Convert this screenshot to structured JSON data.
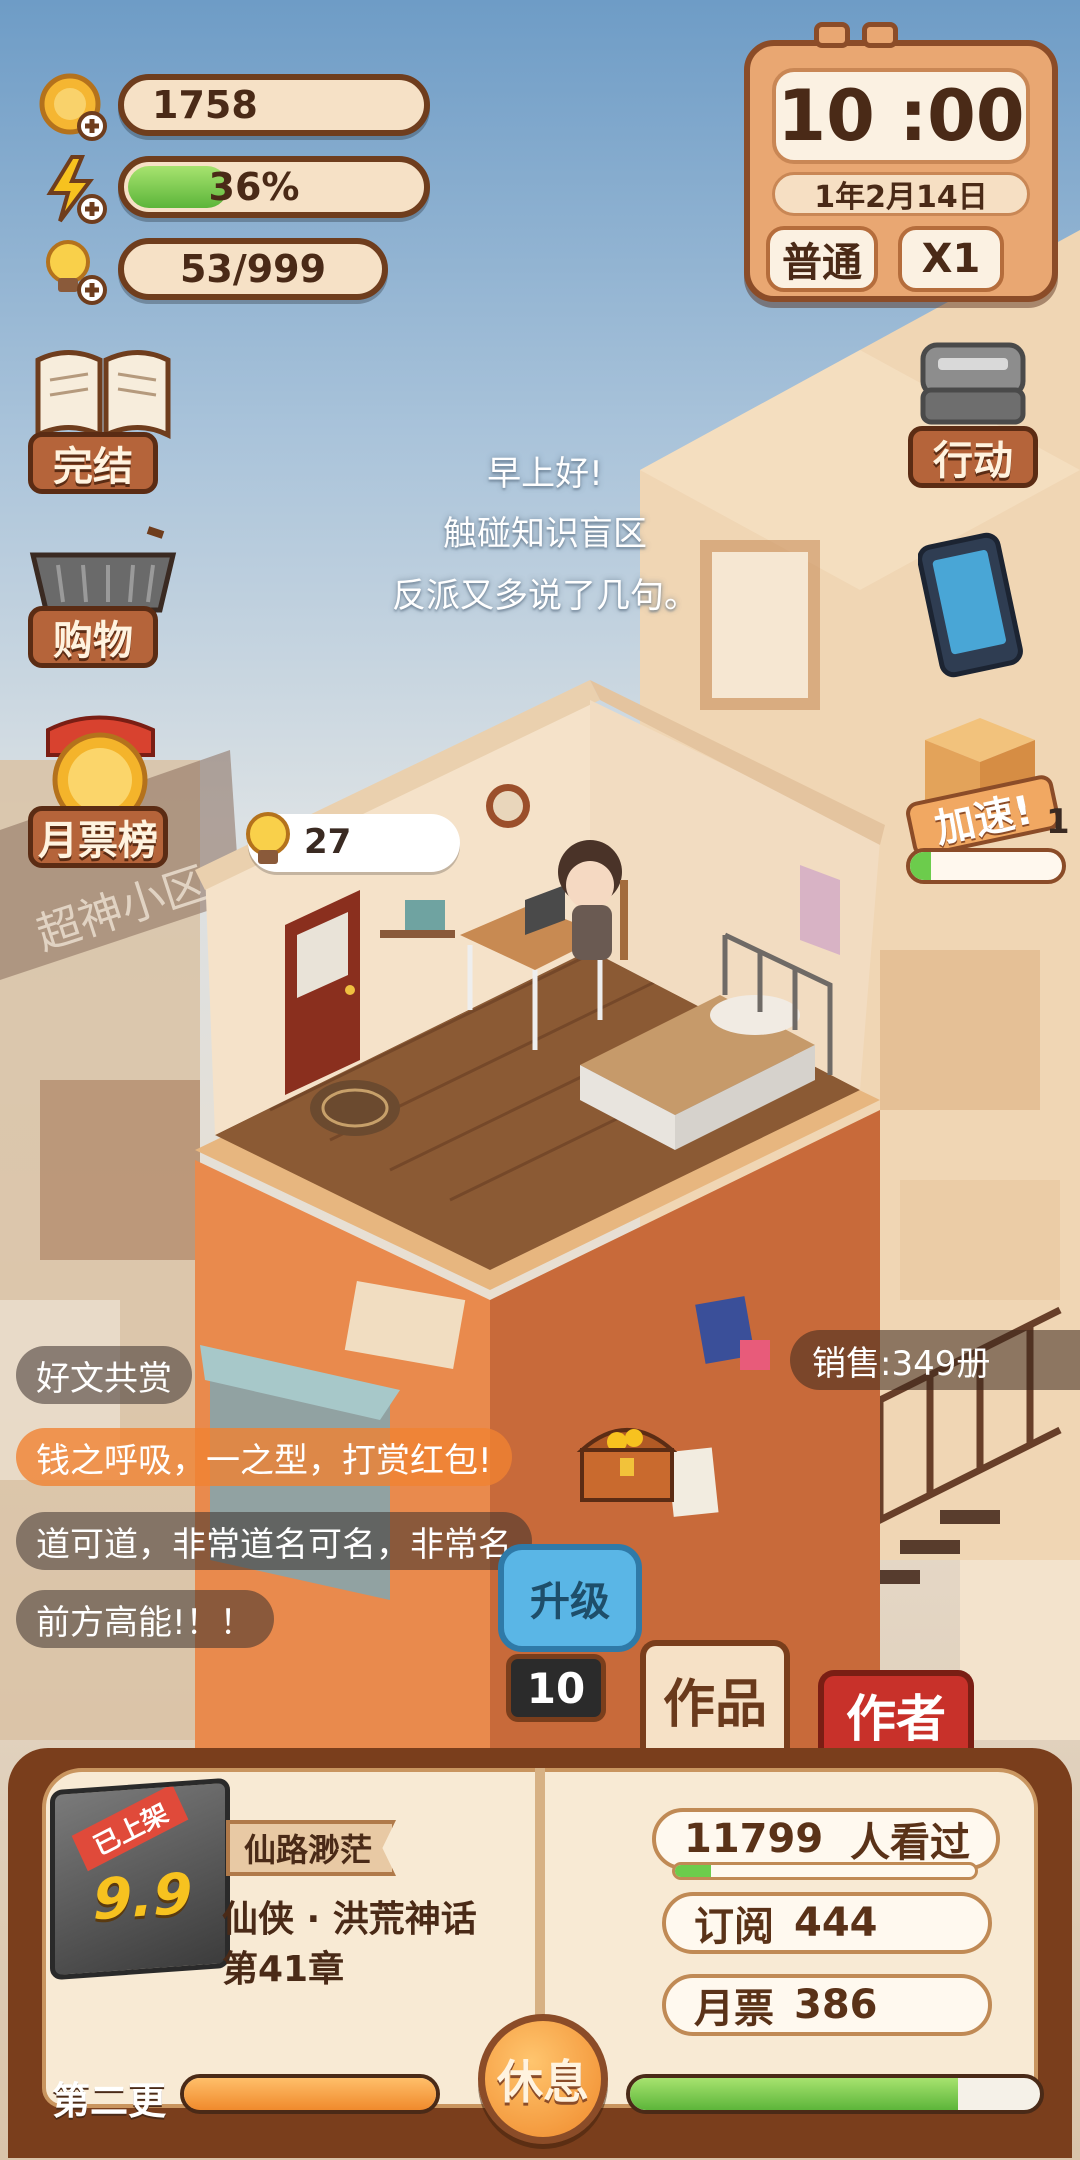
{
  "resources": {
    "coins": "1758",
    "energy_text": "36%",
    "energy_fraction": 0.36,
    "ideas": "53/999"
  },
  "clock": {
    "time": "10 :00",
    "date": "1年2月14日",
    "mode": "普通",
    "speed": "X1"
  },
  "left_menu": {
    "finish": "完结",
    "shop": "购物",
    "ranking": "月票榜"
  },
  "right_menu": {
    "action": "行动",
    "speedup": "加速!",
    "speedup_count": "1"
  },
  "thought": {
    "line1": "早上好!",
    "line2": "触碰知识盲区",
    "line3": "反派又多说了几句。"
  },
  "room": {
    "idea_count": "27",
    "sign_text": "超神小区",
    "sales": "销售:349册",
    "upgrade_label": "升级",
    "counter": "10"
  },
  "chat": [
    "好文共赏",
    "钱之呼吸，一之型，打赏红包!",
    "道可道，非常道名可名，非常名",
    "前方高能!！！"
  ],
  "tabs": {
    "works": "作品",
    "author": "作者"
  },
  "novel": {
    "badge": "已上架",
    "rating": "9.9",
    "title": "仙路渺茫",
    "genre": "仙侠 · 洪荒神话",
    "chapter": "第41章"
  },
  "stats": {
    "viewers_count": "11799",
    "viewers_label": "人看过",
    "viewers_fraction": 0.12,
    "subscribe": "订阅",
    "subscribe_count": "444",
    "monthly": "月票",
    "monthly_count": "386"
  },
  "bottom": {
    "shift_label": "第二更",
    "rest_button": "休息",
    "left_progress": 1.0,
    "right_progress": 0.8
  },
  "colors": {
    "wood_dark": "#6f3d1d",
    "cream": "#f6e1c6",
    "energy_green": "#7ccf4f",
    "orange": "#f08a2c",
    "wall_orange": "#e98a4d"
  }
}
